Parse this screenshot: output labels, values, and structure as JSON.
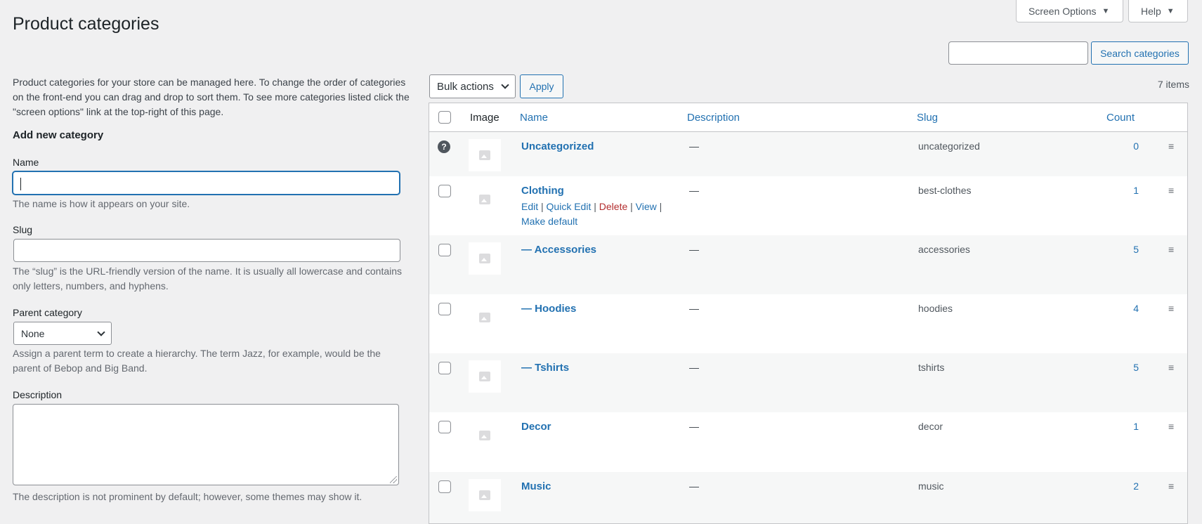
{
  "screen_meta": {
    "screen_options_label": "Screen Options",
    "help_label": "Help"
  },
  "page_title": "Product categories",
  "search": {
    "input_value": "",
    "button_label": "Search categories"
  },
  "intro_text": "Product categories for your store can be managed here. To change the order of categories on the front-end you can drag and drop to sort them. To see more categories listed click the \"screen options\" link at the top-right of this page.",
  "form": {
    "heading": "Add new category",
    "name_label": "Name",
    "name_value": "",
    "name_help": "The name is how it appears on your site.",
    "slug_label": "Slug",
    "slug_value": "",
    "slug_help": "The “slug” is the URL-friendly version of the name. It is usually all lowercase and contains only letters, numbers, and hyphens.",
    "parent_label": "Parent category",
    "parent_selected": "None",
    "parent_help": "Assign a parent term to create a hierarchy. The term Jazz, for example, would be the parent of Bebop and Big Band.",
    "description_label": "Description",
    "description_value": "",
    "description_help": "The description is not prominent by default; however, some themes may show it."
  },
  "toolbar": {
    "bulk_actions_label": "Bulk actions",
    "apply_label": "Apply",
    "items_count": "7 items"
  },
  "table": {
    "headers": {
      "image": "Image",
      "name": "Name",
      "description": "Description",
      "slug": "Slug",
      "count": "Count"
    },
    "rows": [
      {
        "name": "Uncategorized",
        "description": "—",
        "slug": "uncategorized",
        "count": "0",
        "help_icon": "?"
      },
      {
        "name": "Clothing",
        "description": "—",
        "slug": "best-clothes",
        "count": "1"
      },
      {
        "name": "— Accessories",
        "description": "—",
        "slug": "accessories",
        "count": "5"
      },
      {
        "name": "— Hoodies",
        "description": "—",
        "slug": "hoodies",
        "count": "4"
      },
      {
        "name": "— Tshirts",
        "description": "—",
        "slug": "tshirts",
        "count": "5"
      },
      {
        "name": "Decor",
        "description": "—",
        "slug": "decor",
        "count": "1"
      },
      {
        "name": "Music",
        "description": "—",
        "slug": "music",
        "count": "2"
      }
    ],
    "row_actions": {
      "edit": "Edit",
      "quick_edit": "Quick Edit",
      "delete": "Delete",
      "view": "View",
      "make_default": "Make default",
      "separator": "|"
    },
    "drag_handle_glyph": "≡"
  }
}
